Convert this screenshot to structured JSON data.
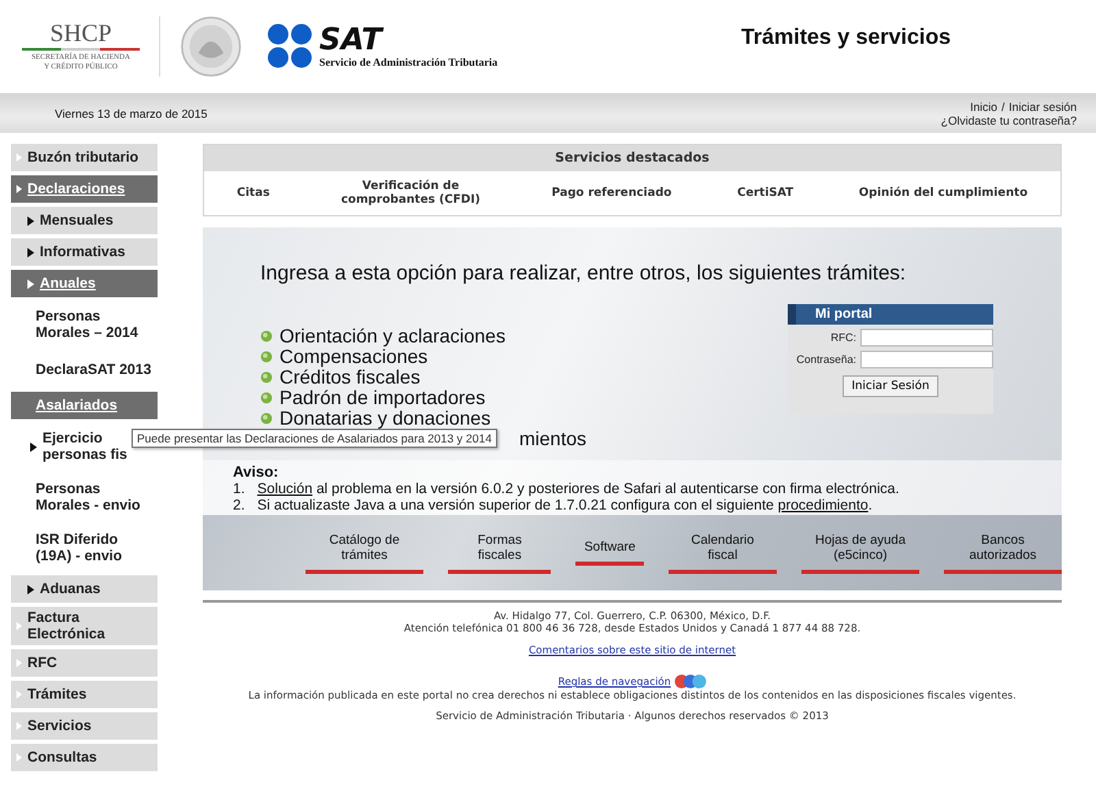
{
  "header": {
    "shcp_name": "SHCP",
    "shcp_line1": "SECRETARÍA DE HACIENDA",
    "shcp_line2": "Y CRÉDITO PÚBLICO",
    "sat_name": "SAT",
    "sat_subtitle": "Servicio de Administración Tributaria",
    "title": "Trámites y servicios"
  },
  "top_bar": {
    "date": "Viernes 13 de marzo de 2015",
    "home_link": "Inicio",
    "separator": "/",
    "login_link": "Iniciar sesión",
    "forgot_link": "¿Olvidaste tu contraseña?"
  },
  "sidebar": {
    "items": [
      {
        "label": "Buzón tributario",
        "kind": "top",
        "selected": false
      },
      {
        "label": "Declaraciones",
        "kind": "top",
        "selected": true
      },
      {
        "label": "Mensuales",
        "kind": "sub",
        "selected": false
      },
      {
        "label": "Informativas",
        "kind": "sub",
        "selected": false
      },
      {
        "label": "Anuales",
        "kind": "sub",
        "selected": true
      },
      {
        "label": "Personas Morales – 2014",
        "kind": "plain",
        "selected": false
      },
      {
        "label": "DeclaraSAT 2013",
        "kind": "plain",
        "selected": false
      },
      {
        "label": "Asalariados",
        "kind": "section",
        "selected": true
      },
      {
        "label": "Ejercicio\npersonas fis",
        "kind": "arrowplain",
        "selected": false
      },
      {
        "label": "Personas Morales - envio",
        "kind": "plain",
        "selected": false
      },
      {
        "label": "ISR Diferido (19A) - envio",
        "kind": "plain",
        "selected": false
      },
      {
        "label": "Aduanas",
        "kind": "sub",
        "selected": false
      },
      {
        "label": "Factura Electrónica",
        "kind": "top",
        "selected": false
      },
      {
        "label": "RFC",
        "kind": "top",
        "selected": false
      },
      {
        "label": "Trámites",
        "kind": "top",
        "selected": false
      },
      {
        "label": "Servicios",
        "kind": "top",
        "selected": false
      },
      {
        "label": "Consultas",
        "kind": "top",
        "selected": false
      }
    ]
  },
  "tooltip": "Puede presentar las Declaraciones de Asalariados para 2013 y 2014",
  "featured": {
    "title": "Servicios destacados",
    "items": [
      "Citas",
      "Verificación de comprobantes (CFDI)",
      "Pago referenciado",
      "CertiSAT",
      "Opinión del cumplimiento"
    ]
  },
  "panel": {
    "intro": "Ingresa a esta opción para realizar, entre otros, los siguientes trámites:",
    "bullets": [
      {
        "text": "Orientación y aclaraciones",
        "covered": false
      },
      {
        "text": "Compensaciones",
        "covered": false
      },
      {
        "text": "Créditos fiscales",
        "covered": false
      },
      {
        "text": "Padrón de importadores",
        "covered": false
      },
      {
        "text": "Donatarias y donaciones",
        "covered": false
      },
      {
        "text": "mientos",
        "covered": true
      }
    ],
    "login": {
      "title": "Mi portal",
      "rfc_label": "RFC:",
      "password_label": "Contraseña:",
      "button": "Iniciar Sesión"
    },
    "notice": {
      "title": "Aviso:",
      "items": [
        {
          "number": "1.",
          "parts": [
            {
              "text": "Solución",
              "link": true
            },
            {
              "text": " al problema en la versión 6.0.2 y posteriores de Safari al autenticarse con firma electrónica.",
              "link": false
            }
          ]
        },
        {
          "number": "2.",
          "parts": [
            {
              "text": "Si actualizaste Java a una versión superior de 1.7.0.21 configura con el siguiente ",
              "link": false
            },
            {
              "text": "procedimiento",
              "link": true
            },
            {
              "text": ".",
              "link": false
            }
          ]
        }
      ]
    },
    "links": [
      "Catálogo de trámites",
      "Formas fiscales",
      "Software",
      "Calendario fiscal",
      "Hojas de ayuda (e5cinco)",
      "Bancos autorizados"
    ]
  },
  "footer": {
    "address": "Av. Hidalgo 77, Col. Guerrero, C.P. 06300, México, D.F.",
    "phone": "Atención telefónica 01 800 46 36 728, desde Estados Unidos y Canadá 1 877 44 88 728.",
    "comments_link": "Comentarios sobre este sitio de internet",
    "rules_link": "Reglas de navegación",
    "disclaimer": "La información publicada en este portal no crea derechos ni establece obligaciones distintos de los contenidos en las disposiciones fiscales vigentes.",
    "copyright": "Servicio de Administración Tributaria · Algunos derechos reservados © 2013"
  }
}
